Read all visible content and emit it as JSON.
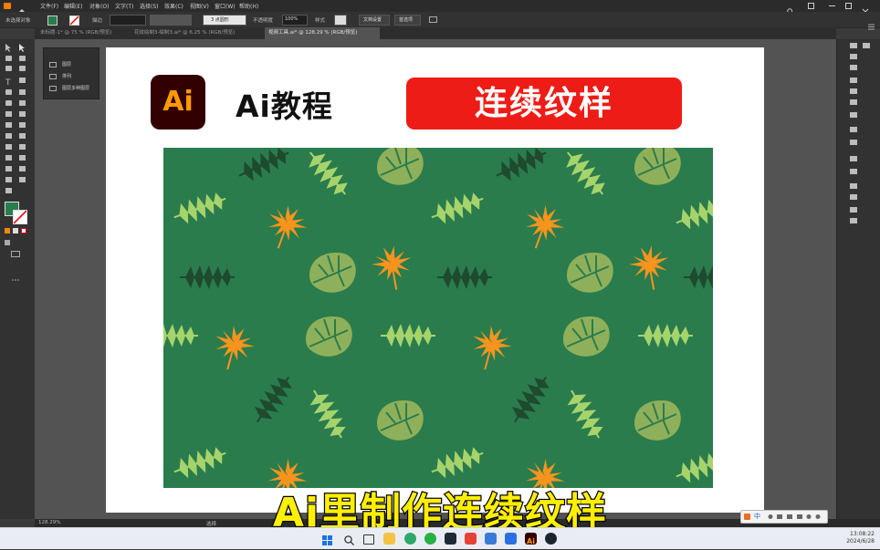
{
  "menubar": {
    "items": [
      "文件(F)",
      "编辑(E)",
      "对象(O)",
      "文字(T)",
      "选择(S)",
      "效果(C)",
      "视图(V)",
      "窗口(W)",
      "帮助(H)"
    ],
    "window_controls": [
      "search-icon",
      "minimize-icon",
      "maximize-icon",
      "close-icon"
    ]
  },
  "control_bar": {
    "label_selection": "未选择对象",
    "label_stroke": "描边",
    "stroke_value": "3 点圆形",
    "opacity_label": "不透明度",
    "opacity_value": "100%",
    "style_label": "样式",
    "doc_setup": "文档设置",
    "prefs": "首选项"
  },
  "tabs": [
    {
      "label": "未标题-1* @ 75 % (RGB/预览)",
      "active": false
    },
    {
      "label": "花纹绘制3-绘制3.ai* @ 6.25 % (RGB/预览)",
      "active": false
    },
    {
      "label": "视频工具.ai* @ 128.29 % (RGB/预览)",
      "active": true
    }
  ],
  "layers_panel": {
    "rows": [
      "图层",
      "排列",
      "图层多种图层"
    ]
  },
  "artboard": {
    "logo_text": "Ai",
    "title": "Ai教程",
    "badge_text": "连续纹样"
  },
  "pattern_colors": {
    "background": "#2a7c4d",
    "orange": "#f7941d",
    "light_green": "#a6d36b",
    "olive": "#8fb05a",
    "dark": "#1e4a2e"
  },
  "subtitle": "Ai里制作连续纹样",
  "status_bar": {
    "zoom": "128.29%",
    "tool": "选择"
  },
  "ime_bar": {
    "lang": "中"
  },
  "taskbar": {
    "time": "13:08:22",
    "date": "2024/6/28"
  }
}
